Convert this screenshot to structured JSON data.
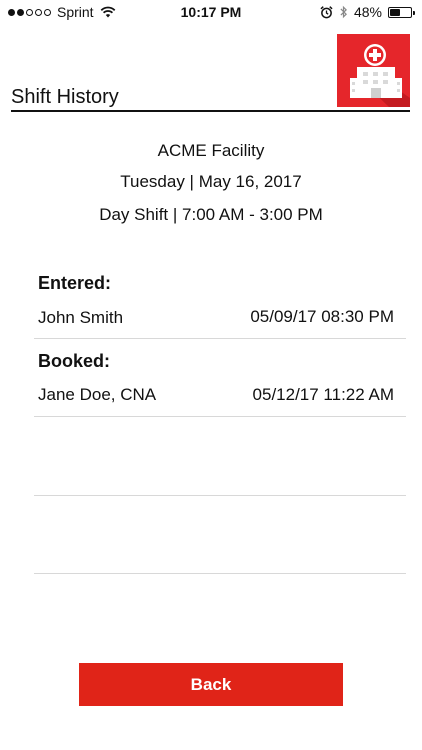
{
  "status_bar": {
    "carrier": "Sprint",
    "signal_bars": 2,
    "signal_total": 5,
    "time": "10:17 PM",
    "battery": "48%",
    "battery_level": 0.48,
    "icons": [
      "wifi-icon",
      "alarm-icon",
      "bluetooth-icon",
      "battery-icon"
    ]
  },
  "header": {
    "title": "Shift History",
    "logo_icon": "hospital-icon",
    "logo_color": "#e5262b"
  },
  "shift": {
    "facility": "ACME Facility",
    "date": "Tuesday | May 16, 2017",
    "shift": "Day Shift | 7:00 AM - 3:00 PM"
  },
  "history": [
    {
      "label": "Entered:",
      "name": "John Smith",
      "datetime": "05/09/17 08:30 PM"
    },
    {
      "label": "Booked:",
      "name": "Jane Doe, CNA",
      "datetime": "05/12/17 11:22 AM"
    }
  ],
  "back_button": {
    "label": "Back",
    "color": "#e02418"
  }
}
